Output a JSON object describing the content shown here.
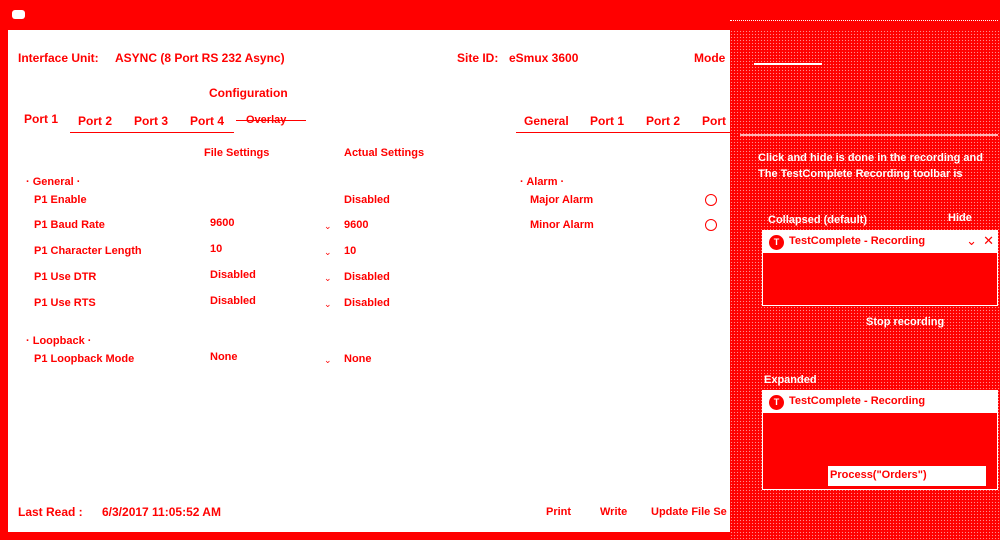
{
  "header": {
    "interface_label": "Interface Unit:",
    "interface_value": "ASYNC (8 Port RS 232 Async)",
    "site_label": "Site ID:",
    "site_value": "eSmux 3600",
    "mode_label": "Mode"
  },
  "section_title": "Configuration",
  "left_tabs": [
    "Port 1",
    "Port 2",
    "Port 3",
    "Port 4",
    "Overlay"
  ],
  "right_tabs": [
    "General",
    "Port 1",
    "Port 2",
    "Port"
  ],
  "columns": {
    "file": "File Settings",
    "actual": "Actual Settings"
  },
  "general": {
    "group": "General",
    "rows": [
      {
        "label": "P1 Enable",
        "file": "",
        "actual": "Disabled"
      },
      {
        "label": "P1 Baud Rate",
        "file": "9600",
        "actual": "9600"
      },
      {
        "label": "P1 Character Length",
        "file": "10",
        "actual": "10"
      },
      {
        "label": "P1 Use DTR",
        "file": "Disabled",
        "actual": "Disabled"
      },
      {
        "label": "P1 Use RTS",
        "file": "Disabled",
        "actual": "Disabled"
      }
    ]
  },
  "loopback": {
    "group": "Loopback",
    "rows": [
      {
        "label": "P1 Loopback Mode",
        "file": "None",
        "actual": "None"
      }
    ]
  },
  "alarm": {
    "group": "Alarm",
    "rows": [
      {
        "label": "Major Alarm"
      },
      {
        "label": "Minor Alarm"
      }
    ]
  },
  "footer": {
    "last_read_label": "Last Read :",
    "last_read_value": "6/3/2017 11:05:52 AM",
    "print": "Print",
    "write": "Write",
    "update": "Update File Se"
  },
  "overlay": {
    "info_line1": "Click and hide is done in the recording and",
    "info_line2": "The TestComplete Recording toolbar is",
    "collapsed_label": "Collapsed (default)",
    "hide_label": "Hide",
    "recording_title_1": "TestComplete - Recording",
    "stop_label": "Stop recording",
    "expanded_label": "Expanded",
    "recording_title_2": "TestComplete - Recording",
    "process_text": "Process(\"Orders\")"
  },
  "colors": {
    "accent": "#ff0000",
    "panel": "#ffffff"
  }
}
